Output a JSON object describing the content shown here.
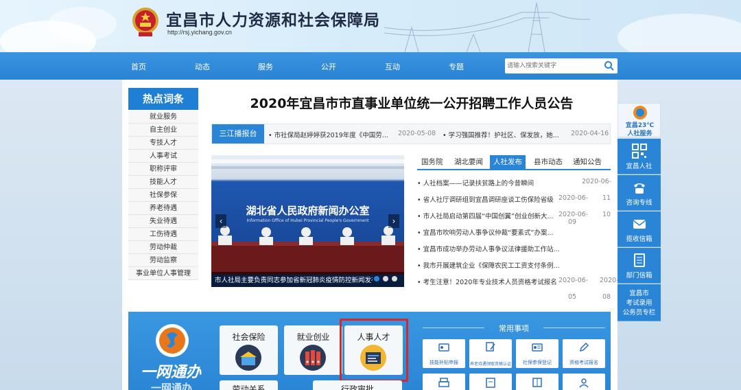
{
  "header": {
    "title": "宜昌市人力资源和社会保障局",
    "url": "http://rsj.yichang.gov.cn"
  },
  "nav": {
    "items": [
      "首页",
      "动态",
      "服务",
      "公开",
      "互动",
      "专题"
    ],
    "search_placeholder": "请输入搜索关键字"
  },
  "hot_words": {
    "title": "热点词条",
    "items": [
      "就业服务",
      "自主创业",
      "专技人才",
      "人事考试",
      "职称评审",
      "技能人才",
      "社保参保",
      "养老待遇",
      "失业待遇",
      "工伤待遇",
      "劳动仲裁",
      "劳动监察",
      "事业单位人事管理"
    ]
  },
  "headline": "2020年宜昌市市直事业单位统一公开招聘工作人员公告",
  "ticker": {
    "label": "三江播报台",
    "items": [
      {
        "text": "• 市社保局赵婷婷获2019年度《中国劳...",
        "date": "2020-05-08"
      },
      {
        "text": "• 学习强国推荐！护社区、保发放，她...",
        "date": "2020-04-16"
      }
    ]
  },
  "slideshow": {
    "backdrop_text": "湖北省人民政府新闻办公室",
    "backdrop_subtext": "Information Office of Hubei Provincial People's Government",
    "caption": "市人社局主要负责同志参加省新冠肺炎疫情防控新闻发布会",
    "prev": "‹",
    "next": "›"
  },
  "news": {
    "tabs": [
      "国务院",
      "湖北要闻",
      "人社发布",
      "县市动态",
      "通知公告"
    ],
    "active_tab": "人社发布",
    "items": [
      {
        "title": "• 人社档案——记录扶贫路上的今昔瞬间",
        "date1": "2020-06-",
        "date2": "11"
      },
      {
        "title": "• 省人社厅调研组到宜昌调研座谈工伤保险省级",
        "date1": "2020-06-",
        "date2": "10"
      },
      {
        "title": "• 市人社局启动第四届“中国创翼”创业创新大...",
        "date1": "2020-06-",
        "date2": "09"
      },
      {
        "title": "• 宜昌市吹响劳动人事争议仲裁“要素式”办案...",
        "date1": "",
        "date2": ""
      },
      {
        "title": "• 宜昌市成功举办劳动人事争议法律援助工作站...",
        "date1": "",
        "date2": ""
      },
      {
        "title": "• 我市开展建筑企业《保障农民工工资支付条例...",
        "date1": "",
        "date2": ""
      },
      {
        "title": "• 考生注意！2020年专业技术人员资格考试报名",
        "date1": "2020-06-",
        "date2": "08"
      }
    ],
    "extra_date": {
      "date1": "2020-06-",
      "date2": "05"
    }
  },
  "sidebar": {
    "logo_line1": "宜昌23℃",
    "logo_line2": "人社服务",
    "buttons": [
      "宜昌人社",
      "咨询专线",
      "揽收信箱",
      "部门信箱"
    ],
    "last_button": [
      "宜昌市",
      "考试录用",
      "公务员专栏"
    ]
  },
  "bottom": {
    "slogan": "一网通办",
    "slogan_sub": "一网通办",
    "cards": [
      "社会保险",
      "就业创业",
      "人事人才"
    ],
    "cards_row2": [
      "劳动关系",
      "行政审批"
    ],
    "common_title": "常用事项",
    "quick": [
      "技能补贴申报",
      "养老待遇领取资格认证",
      "社保参保登记",
      "资格考试报名"
    ]
  },
  "colors": {
    "nav_blue": "#2a85d6",
    "highlight_red": "#d8262c"
  }
}
